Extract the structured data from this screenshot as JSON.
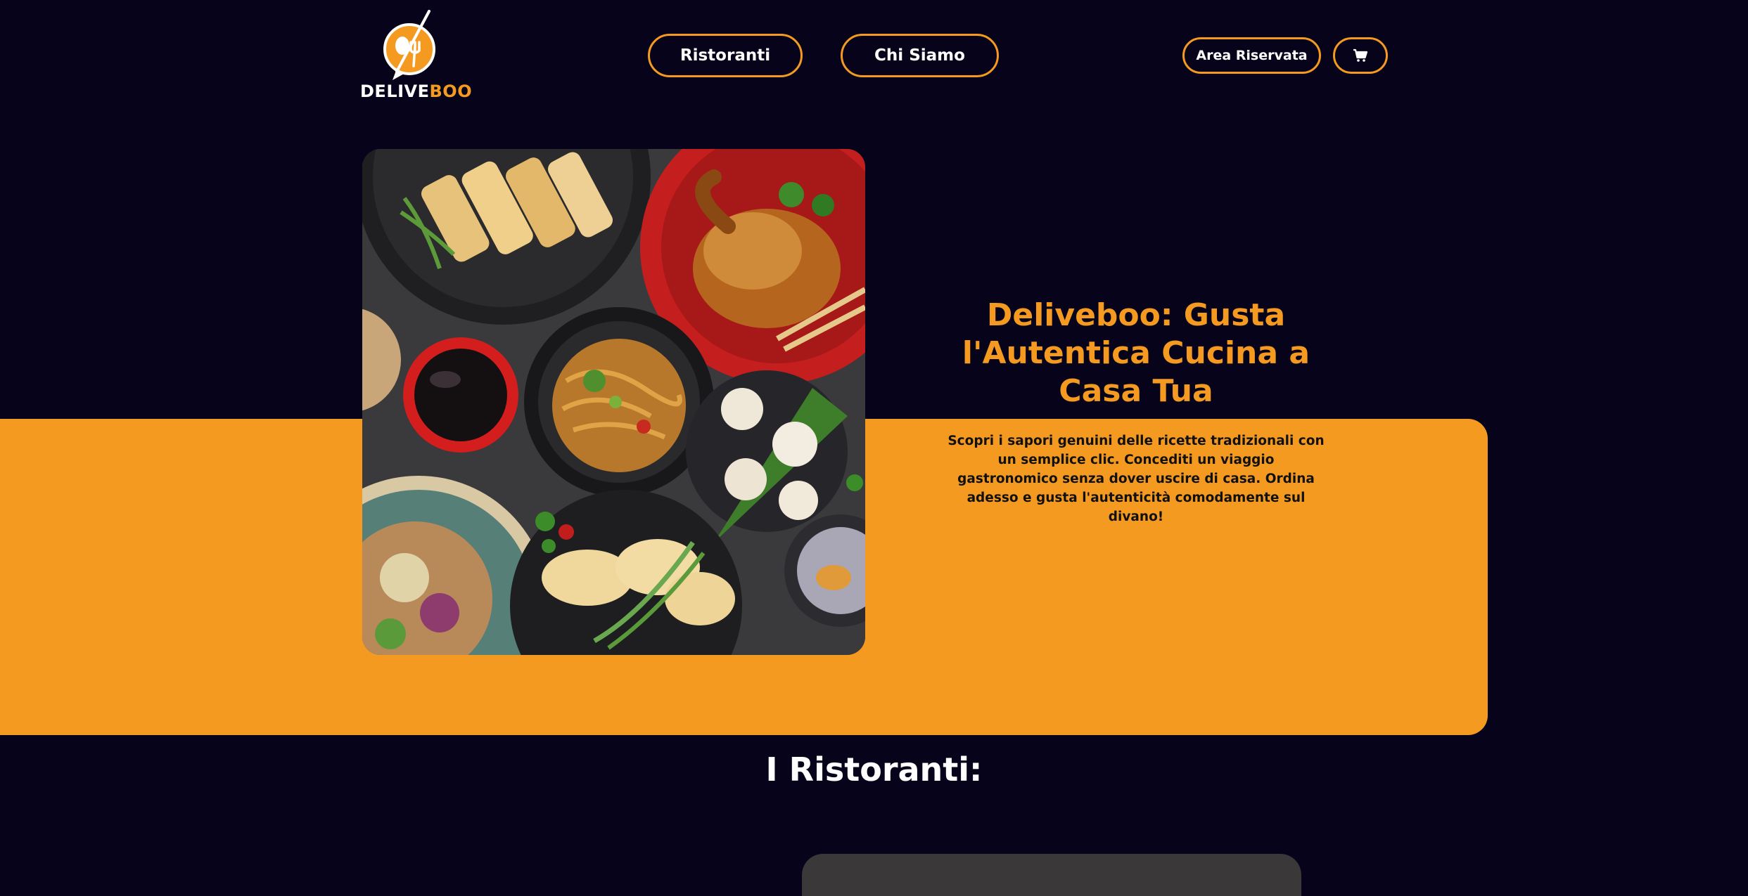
{
  "brand": {
    "name_part1": "DELIVE",
    "name_part2": "BOO",
    "accent_color": "#f59a21",
    "background_color": "#07031a"
  },
  "nav": {
    "ristoranti": "Ristoranti",
    "chi_siamo": "Chi Siamo"
  },
  "header": {
    "area_riservata": "Area Riservata",
    "cart_icon": "cart-icon"
  },
  "hero": {
    "title": "Deliveboo: Gusta l'Autentica Cucina a Casa Tua",
    "description": "Scopri i sapori genuini delle ricette tradizionali con un semplice clic. Concediti un viaggio gastronomico senza dover uscire di casa. Ordina adesso e gusta l'autenticità comodamente sul divano!"
  },
  "restaurants_section": {
    "title": "I Ristoranti:"
  }
}
